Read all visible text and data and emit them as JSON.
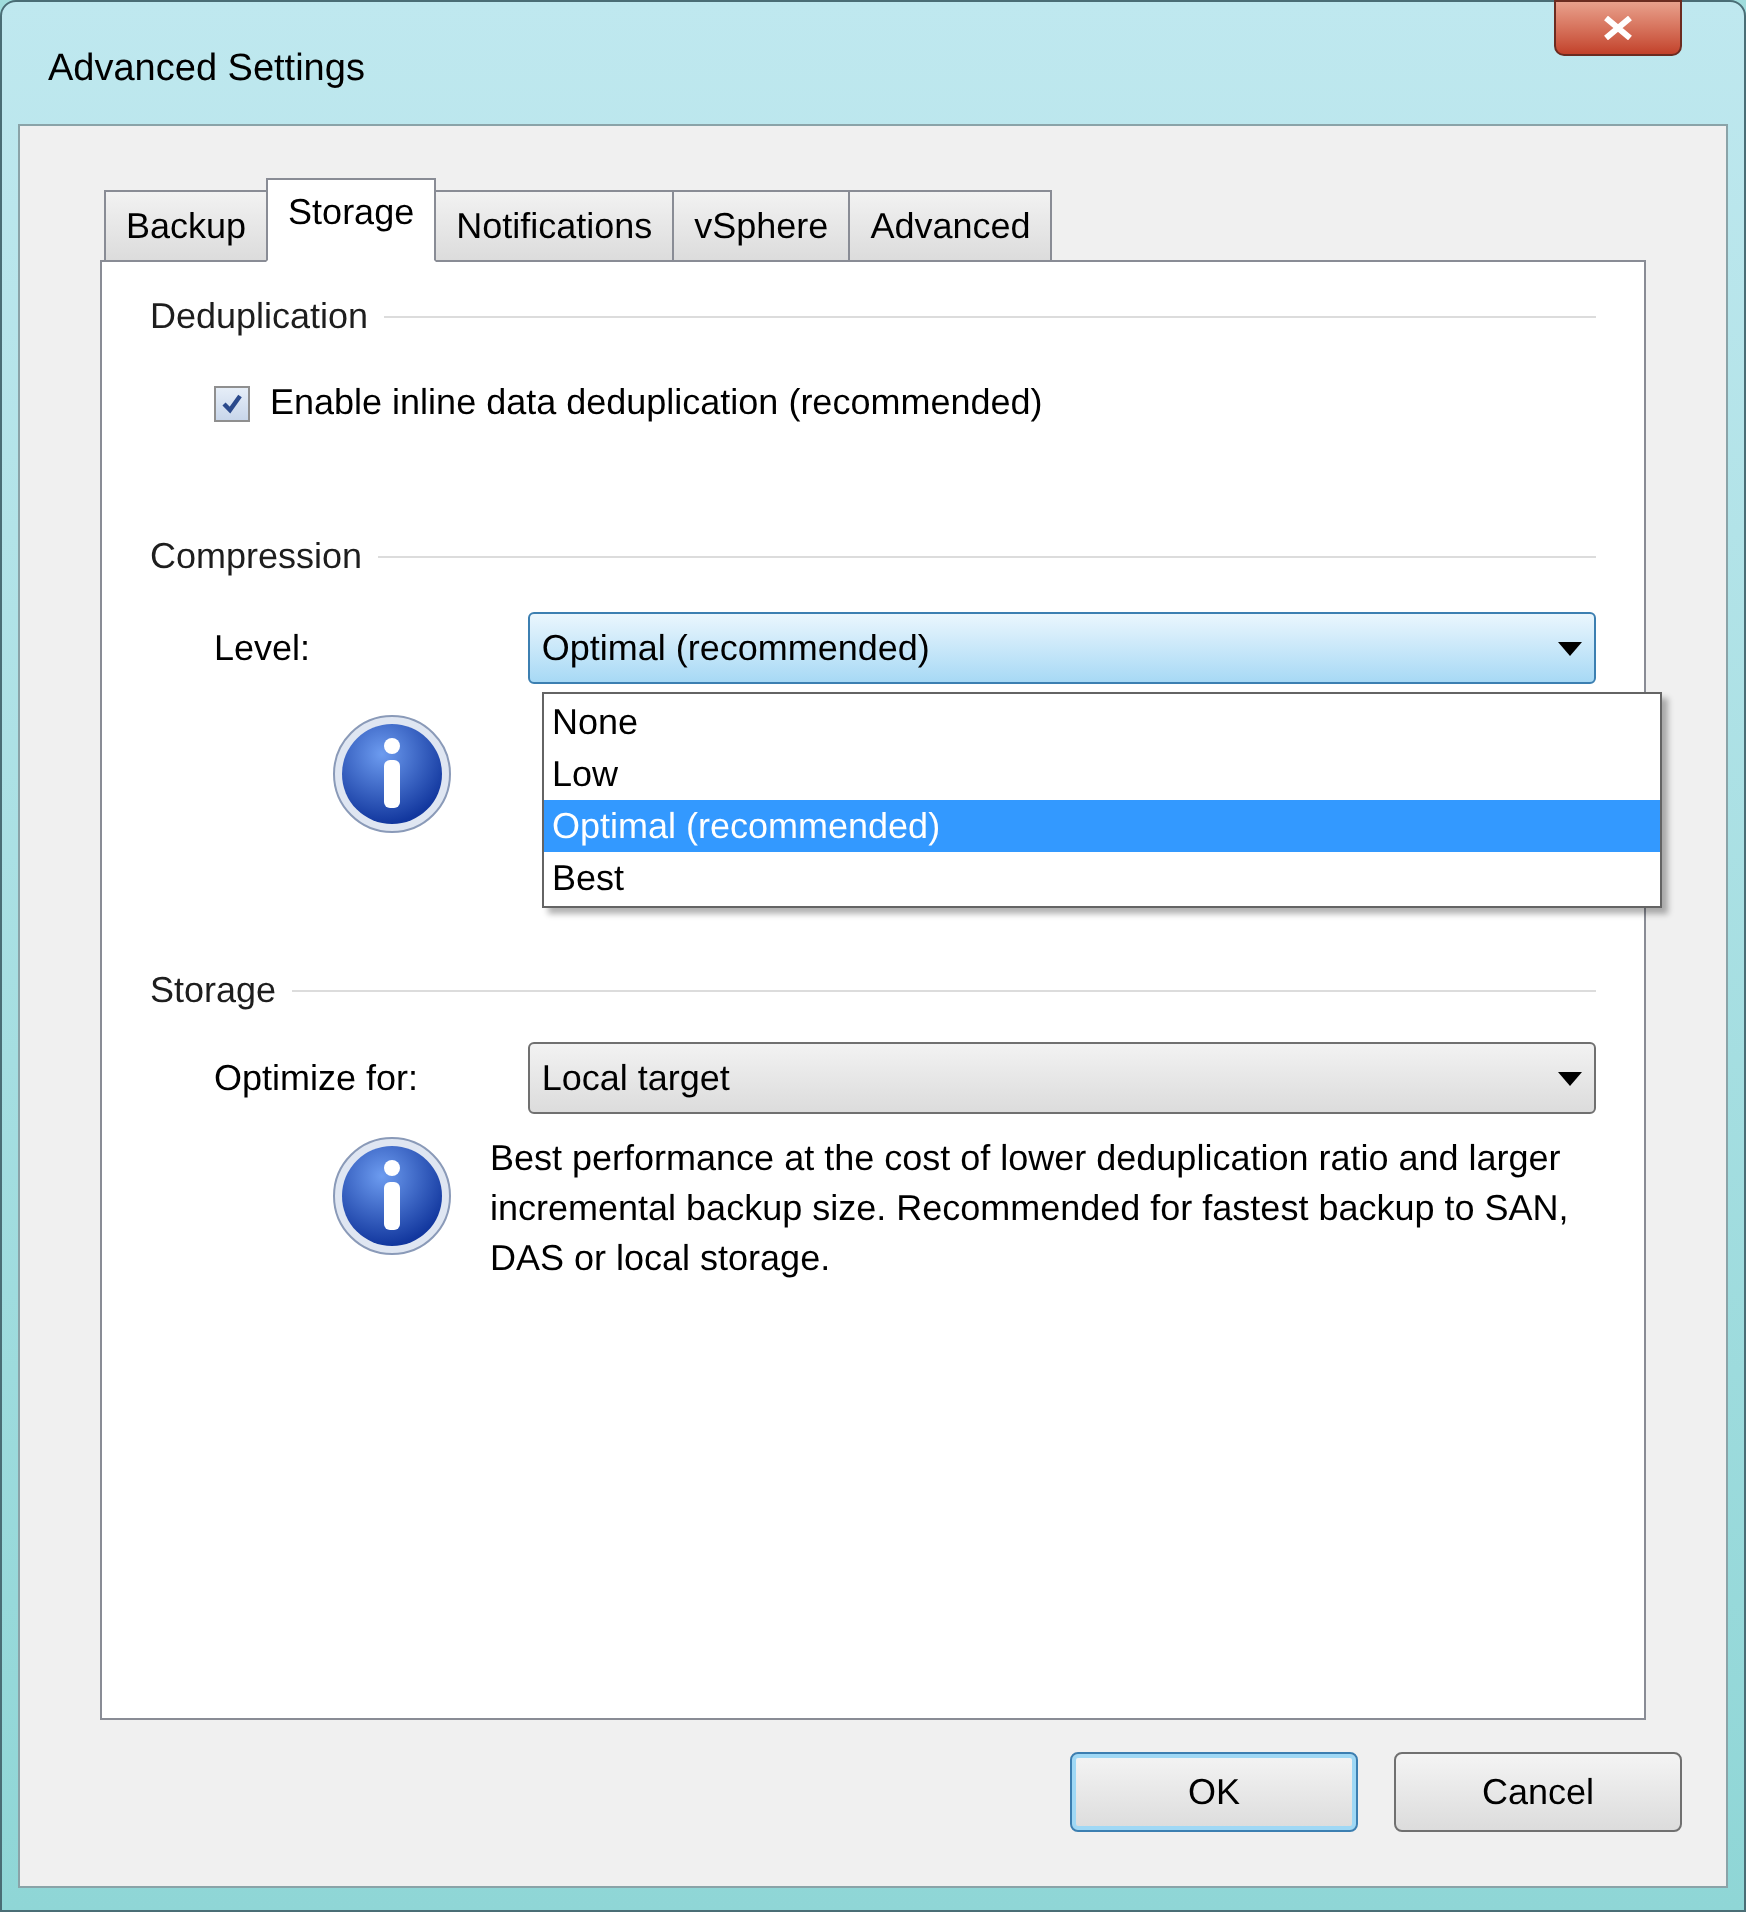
{
  "window": {
    "title": "Advanced Settings"
  },
  "tabs": [
    {
      "label": "Backup",
      "selected": false
    },
    {
      "label": "Storage",
      "selected": true
    },
    {
      "label": "Notifications",
      "selected": false
    },
    {
      "label": "vSphere",
      "selected": false
    },
    {
      "label": "Advanced",
      "selected": false
    }
  ],
  "deduplication": {
    "heading": "Deduplication",
    "checkbox": {
      "label": "Enable inline data deduplication (recommended)",
      "checked": true
    }
  },
  "compression": {
    "heading": "Compression",
    "level_label": "Level:",
    "value": "Optimal (recommended)",
    "expanded": true,
    "options": [
      {
        "label": "None",
        "selected": false
      },
      {
        "label": "Low",
        "selected": false
      },
      {
        "label": "Optimal (recommended)",
        "selected": true
      },
      {
        "label": "Best",
        "selected": false
      }
    ]
  },
  "storage": {
    "heading": "Storage",
    "optimize_label": "Optimize for:",
    "value": "Local target",
    "info": "Best performance at the cost of lower deduplication ratio and larger incremental backup size. Recommended for fastest backup to SAN, DAS or local storage."
  },
  "buttons": [
    {
      "label": "OK",
      "default": true
    },
    {
      "label": "Cancel",
      "default": false
    }
  ]
}
